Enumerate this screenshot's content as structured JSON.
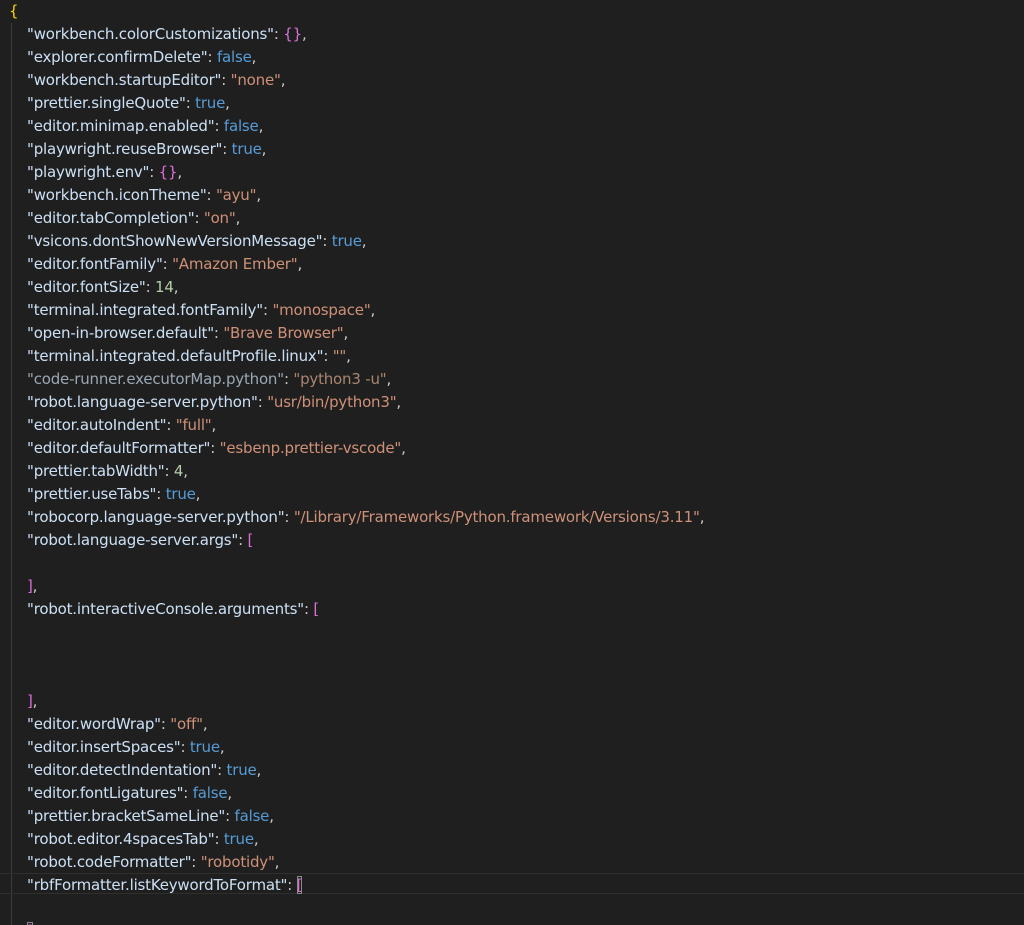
{
  "editor": {
    "open_brace": "{",
    "lines": [
      {
        "key": "\"workbench.colorCustomizations\"",
        "value": "{}",
        "type": "object",
        "comma": true
      },
      {
        "key": "\"explorer.confirmDelete\"",
        "value": "false",
        "type": "bool",
        "comma": true
      },
      {
        "key": "\"workbench.startupEditor\"",
        "value": "\"none\"",
        "type": "string",
        "comma": true
      },
      {
        "key": "\"prettier.singleQuote\"",
        "value": "true",
        "type": "bool",
        "comma": true
      },
      {
        "key": "\"editor.minimap.enabled\"",
        "value": "false",
        "type": "bool",
        "comma": true
      },
      {
        "key": "\"playwright.reuseBrowser\"",
        "value": "true",
        "type": "bool",
        "comma": true
      },
      {
        "key": "\"playwright.env\"",
        "value": "{}",
        "type": "object",
        "comma": true
      },
      {
        "key": "\"workbench.iconTheme\"",
        "value": "\"ayu\"",
        "type": "string",
        "comma": true
      },
      {
        "key": "\"editor.tabCompletion\"",
        "value": "\"on\"",
        "type": "string",
        "comma": true
      },
      {
        "key": "\"vsicons.dontShowNewVersionMessage\"",
        "value": "true",
        "type": "bool",
        "comma": true
      },
      {
        "key": "\"editor.fontFamily\"",
        "value": "\"Amazon Ember\"",
        "type": "string",
        "comma": true
      },
      {
        "key": "\"editor.fontSize\"",
        "value": "14",
        "type": "number",
        "comma": true
      },
      {
        "key": "\"terminal.integrated.fontFamily\"",
        "value": "\"monospace\"",
        "type": "string",
        "comma": true
      },
      {
        "key": "\"open-in-browser.default\"",
        "value": "\"Brave Browser\"",
        "type": "string",
        "comma": true
      },
      {
        "key": "\"terminal.integrated.defaultProfile.linux\"",
        "value": "\"\"",
        "type": "string",
        "comma": true
      },
      {
        "key": "\"code-runner.executorMap.python\"",
        "value": "\"python3 -u\"",
        "type": "string",
        "comma": true,
        "dim": true
      },
      {
        "key": "\"robot.language-server.python\"",
        "value": "\"usr/bin/python3\"",
        "type": "string",
        "comma": true
      },
      {
        "key": "\"editor.autoIndent\"",
        "value": "\"full\"",
        "type": "string",
        "comma": true
      },
      {
        "key": "\"editor.defaultFormatter\"",
        "value": "\"esbenp.prettier-vscode\"",
        "type": "string",
        "comma": true
      },
      {
        "key": "\"prettier.tabWidth\"",
        "value": "4",
        "type": "number",
        "comma": true
      },
      {
        "key": "\"prettier.useTabs\"",
        "value": "true",
        "type": "bool",
        "comma": true
      },
      {
        "key": "\"robocorp.language-server.python\"",
        "value": "\"/Library/Frameworks/Python.framework/Versions/3.11\"",
        "type": "string",
        "comma": true
      },
      {
        "key": "\"robot.language-server.args\"",
        "value": "[",
        "type": "open-bracket",
        "comma": false
      },
      {
        "blank": true
      },
      {
        "close": "]",
        "comma": true
      },
      {
        "key": "\"robot.interactiveConsole.arguments\"",
        "value": "[",
        "type": "open-bracket",
        "comma": false
      },
      {
        "blank": true
      },
      {
        "blank": true
      },
      {
        "blank": true
      },
      {
        "close": "]",
        "comma": true
      },
      {
        "key": "\"editor.wordWrap\"",
        "value": "\"off\"",
        "type": "string",
        "comma": true
      },
      {
        "key": "\"editor.insertSpaces\"",
        "value": "true",
        "type": "bool",
        "comma": true
      },
      {
        "key": "\"editor.detectIndentation\"",
        "value": "true",
        "type": "bool",
        "comma": true
      },
      {
        "key": "\"editor.fontLigatures\"",
        "value": "false",
        "type": "bool",
        "comma": true
      },
      {
        "key": "\"prettier.bracketSameLine\"",
        "value": "false",
        "type": "bool",
        "comma": true
      },
      {
        "key": "\"robot.editor.4spacesTab\"",
        "value": "true",
        "type": "bool",
        "comma": true
      },
      {
        "key": "\"robot.codeFormatter\"",
        "value": "\"robotidy\"",
        "type": "string",
        "comma": true
      },
      {
        "key": "\"rbfFormatter.listKeywordToFormat\"",
        "value": "[",
        "type": "open-bracket",
        "comma": false,
        "matched": true
      },
      {
        "blank": true
      },
      {
        "close": "]",
        "comma": true,
        "matched": true
      }
    ]
  },
  "colors": {
    "background": "#1f1f1f",
    "key": "#cce0f5",
    "string": "#ce9178",
    "boolean": "#569cd6",
    "number": "#b5cea8",
    "bracket_level_1": "#ffd700",
    "bracket_level_2": "#da70d6"
  }
}
